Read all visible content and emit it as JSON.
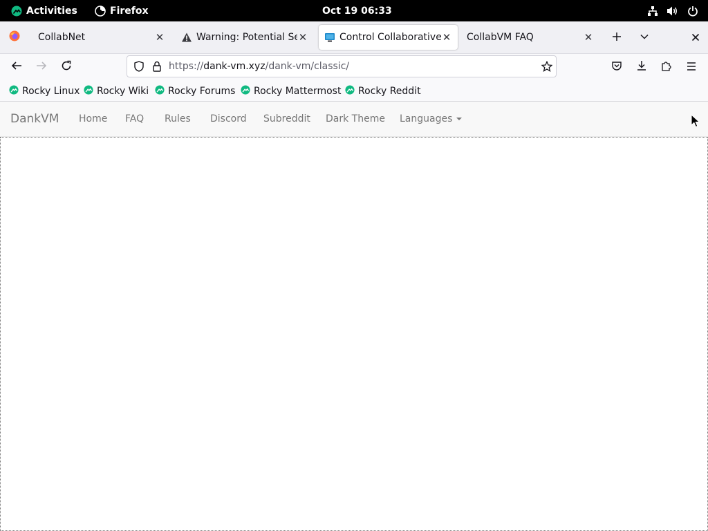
{
  "system_bar": {
    "activities_label": "Activities",
    "app_name": "Firefox",
    "clock": "Oct 19  06:33",
    "tray_icons": [
      "network-icon",
      "volume-icon",
      "power-icon"
    ]
  },
  "tabs": [
    {
      "title": "CollabNet",
      "icon": "firefox-icon",
      "active": false
    },
    {
      "title": "Warning: Potential Security Risk Ahead",
      "icon": "warning-icon",
      "active": false
    },
    {
      "title": "Control Collaborative Virtual Machines!",
      "icon": "monitor-icon",
      "active": true
    },
    {
      "title": "CollabVM FAQ",
      "icon": "",
      "active": false
    }
  ],
  "url_bar": {
    "protocol": "https://",
    "host": "dank-vm.xyz",
    "path": "/dank-vm/classic/"
  },
  "bookmarks": [
    {
      "label": "Rocky Linux"
    },
    {
      "label": "Rocky Wiki"
    },
    {
      "label": "Rocky Forums"
    },
    {
      "label": "Rocky Mattermost"
    },
    {
      "label": "Rocky Reddit"
    }
  ],
  "site_nav": {
    "brand": "DankVM",
    "links": [
      "Home",
      "FAQ",
      "Rules",
      "Discord",
      "Subreddit",
      "Dark Theme",
      "Languages"
    ]
  },
  "colors": {
    "system_bar_bg": "#000000",
    "tab_strip_bg": "#f0f0f4",
    "toolbar_bg": "#f9f9fb",
    "site_nav_bg": "#f8f8f8",
    "site_nav_text": "#777777",
    "rocky_green": "#10b981"
  }
}
